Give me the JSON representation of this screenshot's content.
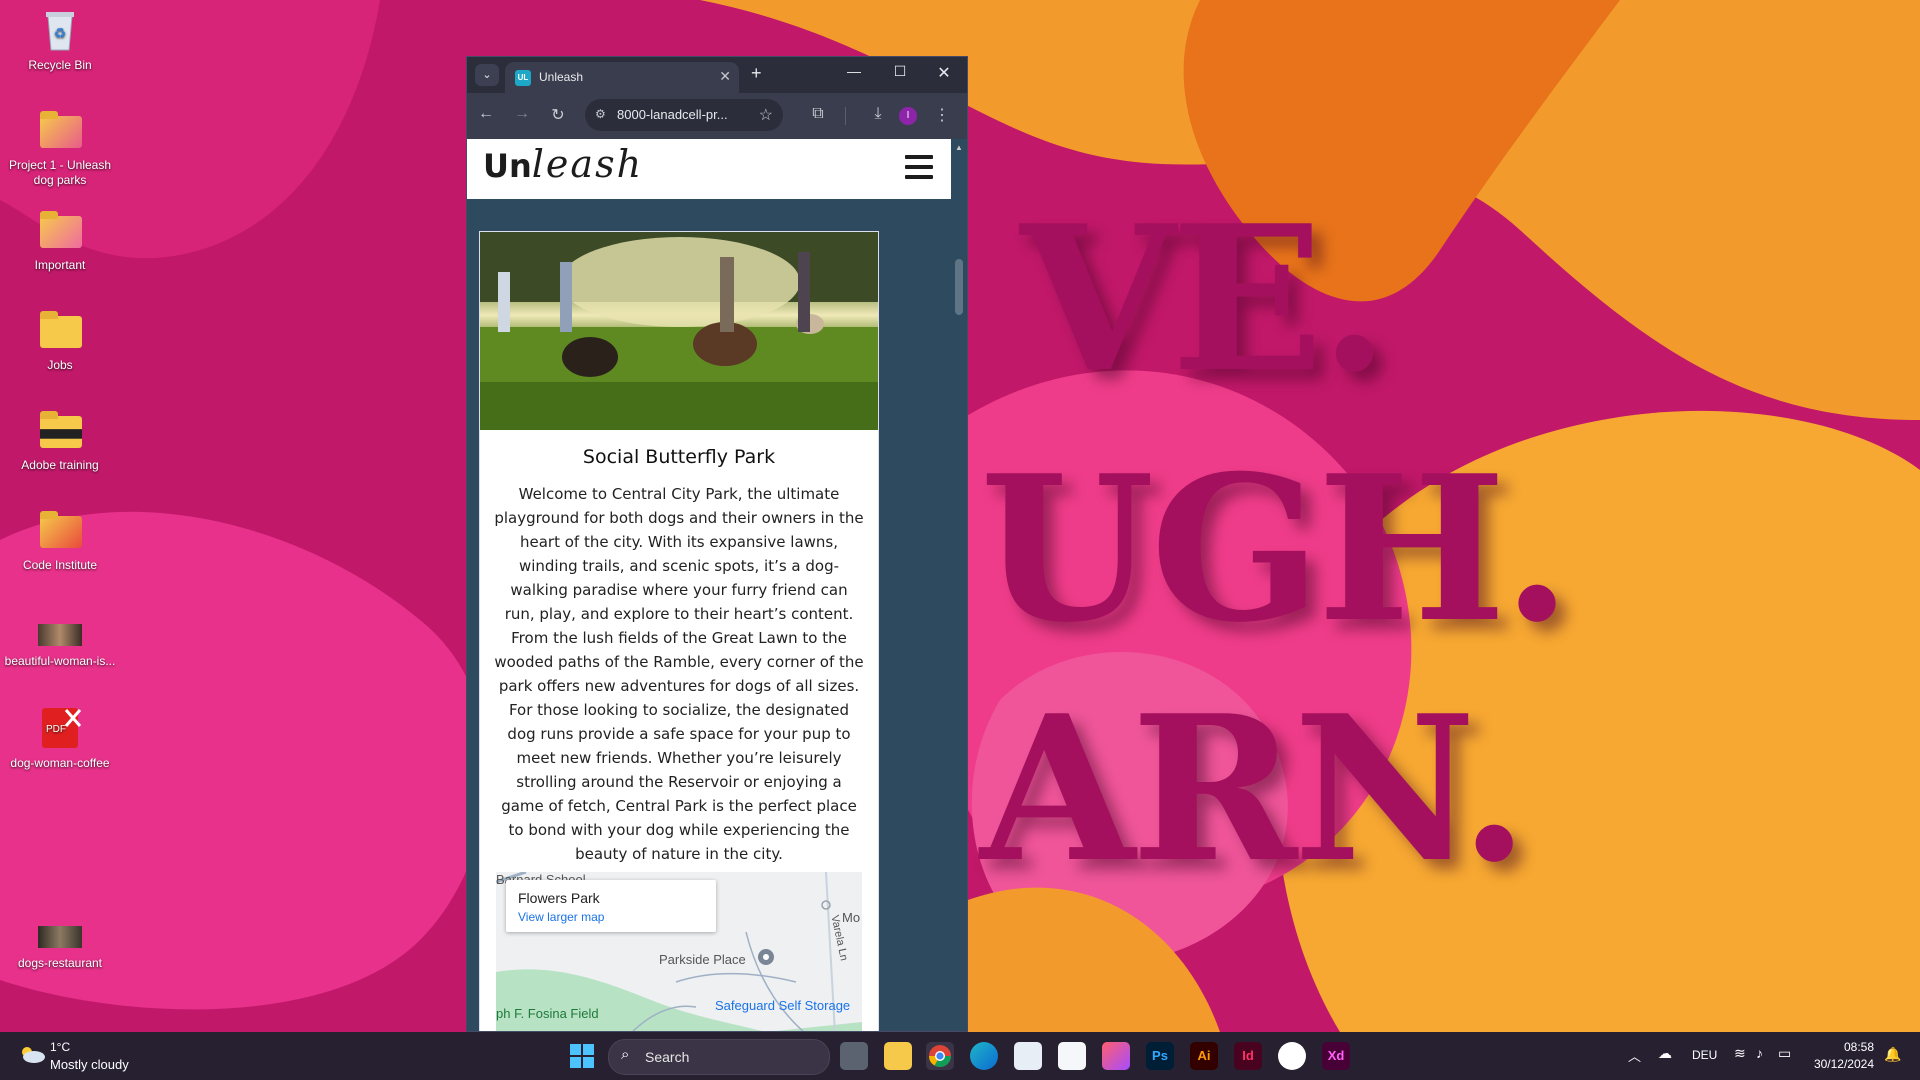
{
  "wallpaper": {
    "words": [
      "VE.",
      "UGH.",
      "ARN."
    ],
    "colors": {
      "magenta": "#c2186a",
      "orange": "#f29b2c",
      "pink": "#ef3c8a",
      "text": "#a5105e"
    }
  },
  "desktop": {
    "icons": [
      {
        "label": "Recycle Bin",
        "icon": "recycle-bin-icon"
      },
      {
        "label": "Project 1 - Unleash dog parks",
        "icon": "folder-icon"
      },
      {
        "label": "Important",
        "icon": "folder-icon"
      },
      {
        "label": "Jobs",
        "icon": "folder-icon"
      },
      {
        "label": "Adobe training",
        "icon": "folder-icon"
      },
      {
        "label": "Code Institute",
        "icon": "folder-icon"
      },
      {
        "label": "beautiful-woman-is...",
        "icon": "image-thumbnail-icon"
      },
      {
        "label": "dog-woman-coffee",
        "icon": "pdf-icon"
      },
      {
        "label": "dogs-restaurant",
        "icon": "image-thumbnail-icon"
      }
    ]
  },
  "browser": {
    "tab_title": "Unleash",
    "favicon_text": "UL",
    "url": "8000-lanadcell-pr...",
    "profile_initial": "I",
    "icons": [
      "tab-list-icon",
      "close-icon",
      "plus-icon",
      "minimize-icon",
      "maximize-icon",
      "back-icon",
      "forward-icon",
      "reload-icon",
      "site-info-icon",
      "star-icon",
      "extensions-icon",
      "download-icon",
      "menu-icon"
    ]
  },
  "site": {
    "logo_bold": "Un",
    "logo_italic": "leash",
    "card": {
      "title": "Social Butterfly Park",
      "description": "Welcome to Central City Park, the ultimate playground for both dogs and their owners in the heart of the city. With its expansive lawns, winding trails, and scenic spots, it’s a dog-walking paradise where your furry friend can run, play, and explore to their heart’s content. From the lush fields of the Great Lawn to the wooded paths of the Ramble, every corner of the park offers new adventures for dogs of all sizes. For those looking to socialize, the designated dog runs provide a safe space for your pup to meet new friends. Whether you’re leisurely strolling around the Reservoir or enjoying a game of fetch, Central Park is the perfect place to bond with your dog while experiencing the beauty of nature in the city."
    },
    "map": {
      "place_name": "Flowers Park",
      "larger_map_link": "View larger map",
      "labels": {
        "school": "Barnard School",
        "mo": "Mo",
        "street": "Varela Ln",
        "parkside": "Parkside Place",
        "field": "ph F. Fosina Field",
        "storage": "Safeguard Self Storage"
      }
    }
  },
  "taskbar": {
    "weather_temp": "1°C",
    "weather_condition": "Mostly cloudy",
    "search_label": "Search",
    "apps": [
      "file-explorer-icon",
      "chrome-icon",
      "edge-icon",
      "store-icon",
      "calendar-icon",
      "creative-cloud-icon",
      "photoshop-icon",
      "illustrator-icon",
      "indesign-icon",
      "slack-icon",
      "xd-icon"
    ],
    "app_labels": {
      "ps": "Ps",
      "ai": "Ai",
      "id": "Id",
      "xd": "Xd"
    },
    "language": "DEU",
    "time": "08:58",
    "date": "30/12/2024"
  }
}
